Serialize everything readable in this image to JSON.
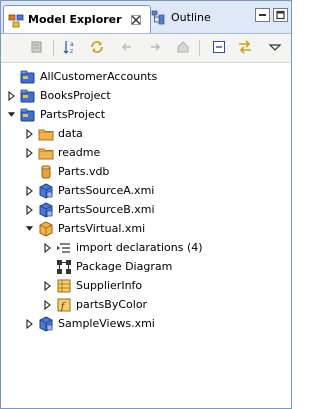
{
  "tabs": [
    {
      "label": "Model Explorer",
      "active": true,
      "icon": "model-explorer-icon"
    },
    {
      "label": "Outline",
      "active": false,
      "icon": "outline-icon"
    }
  ],
  "window_controls": [
    "minimize-icon",
    "maximize-icon"
  ],
  "toolbar": {
    "buttons": [
      "new-model-icon",
      "sort-alphabetical-icon",
      "link-with-editor-icon",
      "back-icon",
      "forward-icon",
      "home-icon",
      "collapse-all-icon",
      "sync-icon",
      "view-menu-icon"
    ]
  },
  "tree": [
    {
      "label": "AllCustomerAccounts",
      "icon": "project-icon",
      "level": 0,
      "expand": "none"
    },
    {
      "label": "BooksProject",
      "icon": "project-icon",
      "level": 0,
      "expand": "collapsed"
    },
    {
      "label": "PartsProject",
      "icon": "project-icon",
      "level": 0,
      "expand": "expanded"
    },
    {
      "label": "data",
      "icon": "folder-icon",
      "level": 1,
      "expand": "collapsed"
    },
    {
      "label": "readme",
      "icon": "folder-icon",
      "level": 1,
      "expand": "collapsed"
    },
    {
      "label": "Parts.vdb",
      "icon": "vdb-icon",
      "level": 1,
      "expand": "none"
    },
    {
      "label": "PartsSourceA.xmi",
      "icon": "source-model-icon",
      "level": 1,
      "expand": "collapsed"
    },
    {
      "label": "PartsSourceB.xmi",
      "icon": "source-model-icon",
      "level": 1,
      "expand": "collapsed"
    },
    {
      "label": "PartsVirtual.xmi",
      "icon": "virtual-model-icon",
      "level": 1,
      "expand": "expanded"
    },
    {
      "label": "import declarations (4)",
      "icon": "import-declarations-icon",
      "level": 2,
      "expand": "collapsed"
    },
    {
      "label": "Package Diagram",
      "icon": "diagram-icon",
      "level": 2,
      "expand": "none"
    },
    {
      "label": "SupplierInfo",
      "icon": "table-icon",
      "level": 2,
      "expand": "collapsed"
    },
    {
      "label": "partsByColor",
      "icon": "procedure-icon",
      "level": 2,
      "expand": "collapsed"
    },
    {
      "label": "SampleViews.xmi",
      "icon": "source-model-icon",
      "level": 1,
      "expand": "collapsed"
    }
  ],
  "colors": {
    "tab_bar": "#dfe8f6",
    "border": "#7a96c2",
    "toolbar": "#f4f4f2",
    "project_blue": "#3b6fd1",
    "folder_orange": "#e8a23a"
  }
}
